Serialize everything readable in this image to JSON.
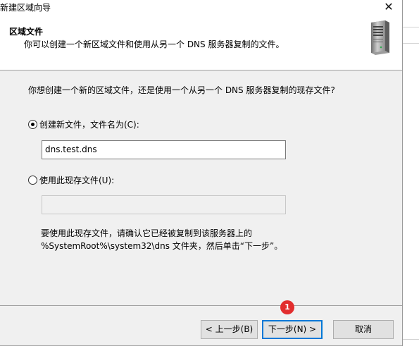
{
  "window": {
    "title": "新建区域向导",
    "close_glyph": "✕"
  },
  "header": {
    "title": "区域文件",
    "subtitle": "你可以创建一个新区域文件和使用从另一个 DNS 服务器复制的文件。",
    "icon": "server-icon"
  },
  "body": {
    "question": "你想创建一个新的区域文件，还是使用一个从另一个 DNS 服务器复制的现存文件?",
    "option_new": {
      "label": "创建新文件，文件名为(C):",
      "selected": true,
      "value": "dns.test.dns"
    },
    "option_existing": {
      "label": "使用此现存文件(U):",
      "selected": false,
      "value": ""
    },
    "note_line1": "要使用此现存文件，请确认它已经被复制到该服务器上的",
    "note_line2": "%SystemRoot%\\system32\\dns 文件夹，然后单击“下一步”。"
  },
  "footer": {
    "back_label": "< 上一步(B)",
    "next_label": "下一步(N) >",
    "cancel_label": "取消",
    "badge": "1"
  },
  "colors": {
    "accent": "#0078d7",
    "badge": "#e22d2d",
    "panel": "#f0f0f0"
  }
}
